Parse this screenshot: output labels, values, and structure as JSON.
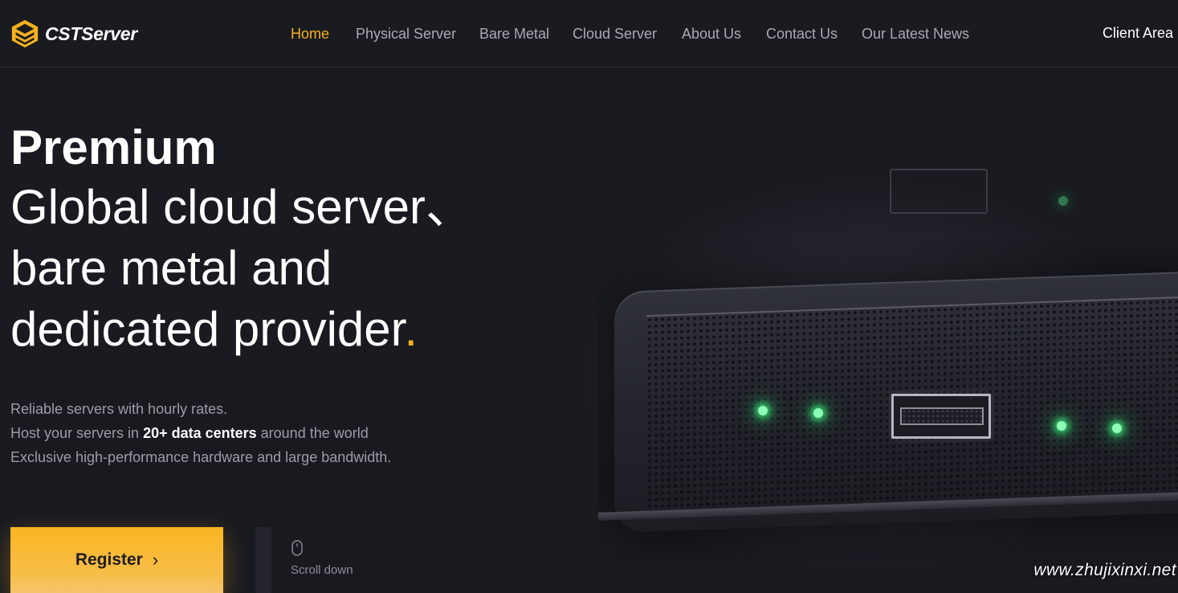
{
  "brand": {
    "name": "CSTServer",
    "accent_color": "#f6b11e",
    "logo_icon": "stacked-layers-logo-icon"
  },
  "nav": {
    "items": [
      {
        "label": "Home",
        "active": true
      },
      {
        "label": "Physical Server",
        "active": false
      },
      {
        "label": "Bare Metal",
        "active": false
      },
      {
        "label": "Cloud Server",
        "active": false
      },
      {
        "label": "About Us",
        "active": false
      },
      {
        "label": "Contact Us",
        "active": false
      },
      {
        "label": "Our Latest News",
        "active": false
      }
    ],
    "client_area": "Client Area"
  },
  "hero": {
    "headline_bold": "Premium",
    "headline_lines": [
      "Global cloud server、",
      "bare metal and",
      "dedicated provider"
    ],
    "headline_end_dot": ".",
    "description": {
      "line1": "Reliable servers with hourly rates.",
      "line2_prefix": "Host your servers in ",
      "line2_bold": "20+ data centers",
      "line2_suffix": " around the world",
      "line3": "Exclusive high-performance hardware and large bandwidth."
    },
    "register_label": "Register",
    "register_icon": "chevron-right-icon",
    "scroll_icon": "mouse-icon",
    "scroll_label": "Scroll down"
  },
  "watermark": "www.zhujixinxi.net"
}
